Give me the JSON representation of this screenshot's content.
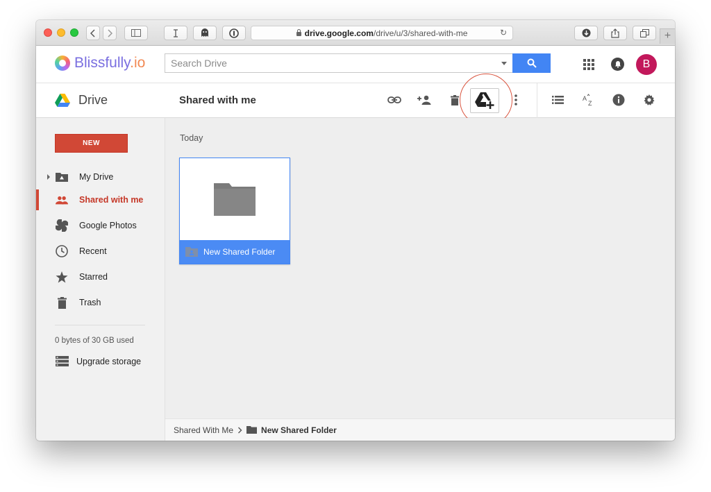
{
  "browser": {
    "url_host": "drive.google.com",
    "url_path": "/drive/u/3/shared-with-me"
  },
  "header": {
    "logo_main": "Blissfully",
    "logo_suffix": ".io",
    "search_placeholder": "Search Drive",
    "avatar_letter": "B",
    "avatar_color": "#c2185b"
  },
  "drivebar": {
    "app_name": "Drive",
    "folder_title": "Shared with me"
  },
  "sidebar": {
    "new_label": "NEW",
    "items": [
      {
        "label": "My Drive",
        "icon": "my-drive-icon"
      },
      {
        "label": "Shared with me",
        "icon": "shared-people-icon",
        "active": true
      },
      {
        "label": "Google Photos",
        "icon": "pinwheel-icon"
      },
      {
        "label": "Recent",
        "icon": "clock-icon"
      },
      {
        "label": "Starred",
        "icon": "star-icon"
      },
      {
        "label": "Trash",
        "icon": "trash-icon"
      }
    ],
    "storage_text": "0 bytes of 30 GB used",
    "upgrade_label": "Upgrade storage"
  },
  "main": {
    "section_label": "Today",
    "folder_name": "New Shared Folder"
  },
  "breadcrumb": {
    "root": "Shared With Me",
    "current": "New Shared Folder"
  },
  "colors": {
    "accent_blue": "#4285f4",
    "new_red": "#d14836",
    "highlight_ring": "#d9533d"
  }
}
